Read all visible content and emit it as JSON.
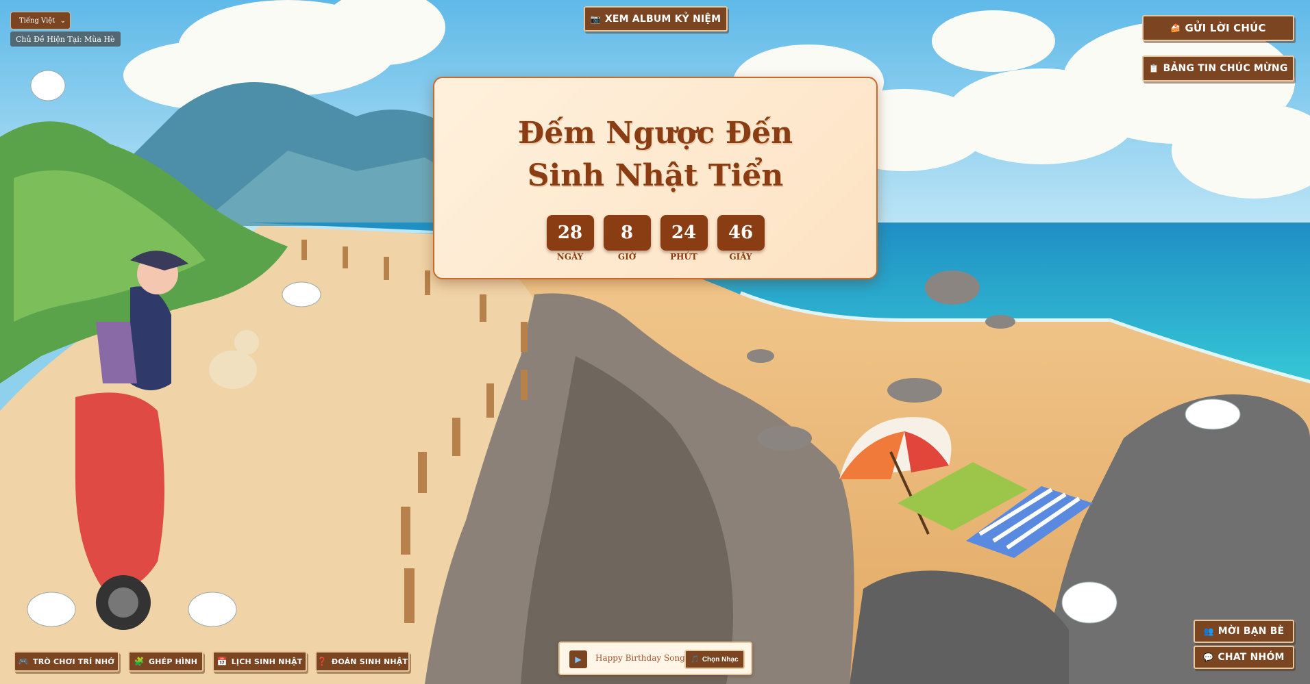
{
  "language": {
    "selected": "Tiếng Việt"
  },
  "theme": {
    "label": "Chủ Đề Hiện Tại: Mùa Hè"
  },
  "top": {
    "album_label": "XEM ALBUM KỶ NIỆM",
    "album_icon": "camera-icon"
  },
  "right_menu": {
    "wish_label": "GỬI LỜI CHÚC",
    "wish_icon": "cake-icon",
    "board_label": "BẢNG TIN CHÚC MỪNG",
    "board_icon": "clipboard-icon"
  },
  "countdown": {
    "title": "Đếm Ngược Đến Sinh Nhật Tiển",
    "units": [
      {
        "value": "28",
        "label": "NGÀY"
      },
      {
        "value": "8",
        "label": "GIỜ"
      },
      {
        "value": "24",
        "label": "PHÚT"
      },
      {
        "value": "46",
        "label": "GIÂY"
      }
    ]
  },
  "games": [
    {
      "label": "TRÒ CHƠI TRÍ NHỚ",
      "icon": "gamepad-icon"
    },
    {
      "label": "GHÉP HÌNH",
      "icon": "puzzle-icon"
    },
    {
      "label": "LỊCH SINH NHẬT",
      "icon": "calendar-icon"
    },
    {
      "label": "ĐOÁN SINH NHẬT",
      "icon": "question-icon"
    }
  ],
  "player": {
    "song": "Happy Birthday Song",
    "pick_label": "Chọn Nhạc"
  },
  "social": {
    "invite_label": "MỜI BẠN BÈ",
    "chat_label": "CHAT NHÓM"
  },
  "colors": {
    "button_bg": "#7a4520",
    "button_border": "#e8c79e",
    "title_color": "#8a3c12",
    "card_bg": "#fff1dd"
  }
}
